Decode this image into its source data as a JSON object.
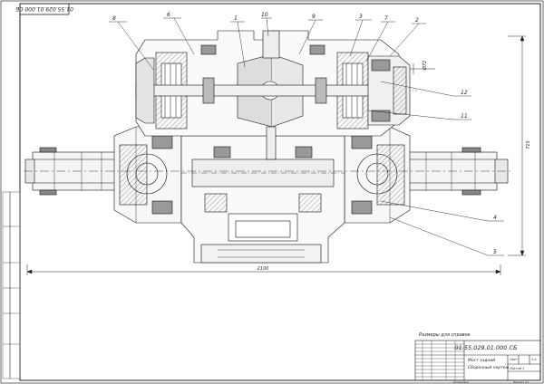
{
  "sheet": {
    "designation_rotated": "01.55.029.01.000 СБ",
    "note": "Размеры для справок",
    "dimension_width": "2100",
    "dimension_height": "715",
    "dimension_small": "Ø72",
    "callouts": [
      "8",
      "6",
      "1",
      "10",
      "9",
      "3",
      "7",
      "2",
      "12",
      "11",
      "4",
      "5"
    ]
  },
  "title_block": {
    "designation": "01.55.029.01.000 СБ",
    "name_line1": "Мост задний",
    "name_line2": "Сборочный чертеж",
    "sheet_label": "Лист",
    "scale": "1:4",
    "mass": "",
    "sheets_text": "Листов 1",
    "copied": "Копировал",
    "format": "Формат А1"
  }
}
